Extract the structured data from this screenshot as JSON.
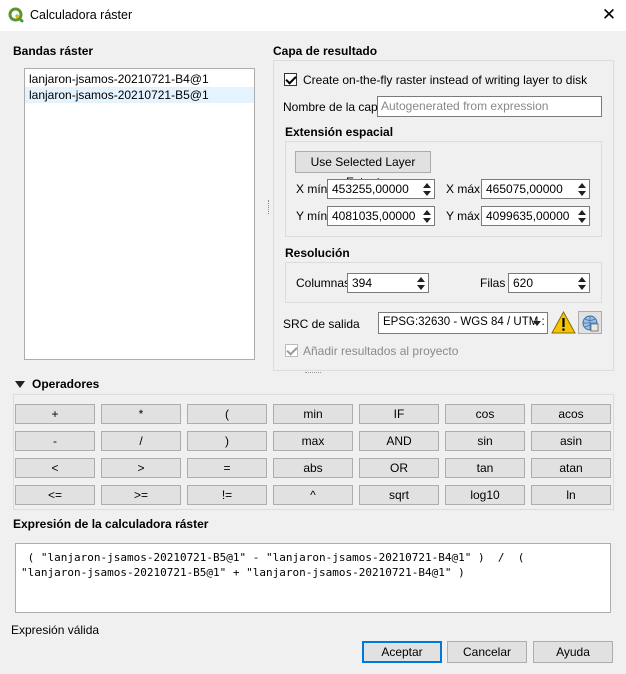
{
  "window": {
    "title": "Calculadora ráster",
    "close_glyph": "✕"
  },
  "bands": {
    "title": "Bandas ráster",
    "items": [
      "lanjaron-jsamos-20210721-B4@1",
      "lanjaron-jsamos-20210721-B5@1"
    ]
  },
  "result": {
    "title": "Capa de resultado",
    "onfly_label": "Create on-the-fly raster instead of writing layer to disk",
    "onfly_checked": true,
    "layer_name_label": "Nombre de la capa",
    "layer_name_placeholder": "Autogenerated from expression",
    "extent": {
      "title": "Extensión espacial",
      "use_selected_label": "Use Selected Layer Extent",
      "xmin_label": "X mín",
      "xmin_value": "453255,00000",
      "xmax_label": "X máx",
      "xmax_value": "465075,00000",
      "ymin_label": "Y mín",
      "ymin_value": "4081035,00000",
      "ymax_label": "Y máx",
      "ymax_value": "4099635,00000"
    },
    "resolution": {
      "title": "Resolución",
      "cols_label": "Columnas",
      "cols_value": "394",
      "rows_label": "Filas",
      "rows_value": "620"
    },
    "crs_label": "SRC de salida",
    "crs_value": "EPSG:32630 - WGS 84 / UTM :",
    "add_results_label": "Añadir resultados al proyecto",
    "add_results_checked": true
  },
  "operators": {
    "title": "Operadores",
    "buttons": [
      [
        "+",
        "*",
        "(",
        "min",
        "IF",
        "cos",
        "acos"
      ],
      [
        "-",
        "/",
        ")",
        "max",
        "AND",
        "sin",
        "asin"
      ],
      [
        "<",
        ">",
        "=",
        "abs",
        "OR",
        "tan",
        "atan"
      ],
      [
        "<=",
        ">=",
        "!=",
        "^",
        "sqrt",
        "log10",
        "ln"
      ]
    ]
  },
  "expression": {
    "title": "Expresión de la calculadora ráster",
    "line1": " ( \"lanjaron-jsamos-20210721-B5@1\" - \"lanjaron-jsamos-20210721-B4@1\" )  /  (",
    "line2": "\"lanjaron-jsamos-20210721-B5@1\" + \"lanjaron-jsamos-20210721-B4@1\" )",
    "status": "Expresión válida"
  },
  "footer": {
    "accept": "Aceptar",
    "cancel": "Cancelar",
    "help": "Ayuda"
  },
  "colors": {
    "accent": "#0078d7",
    "qgis_green": "#589632",
    "warning": "#f5c400"
  },
  "icons": [
    "qgis-logo-icon",
    "close-icon",
    "warning-icon",
    "crs-globe-icon",
    "collapse-arrow-icon"
  ]
}
